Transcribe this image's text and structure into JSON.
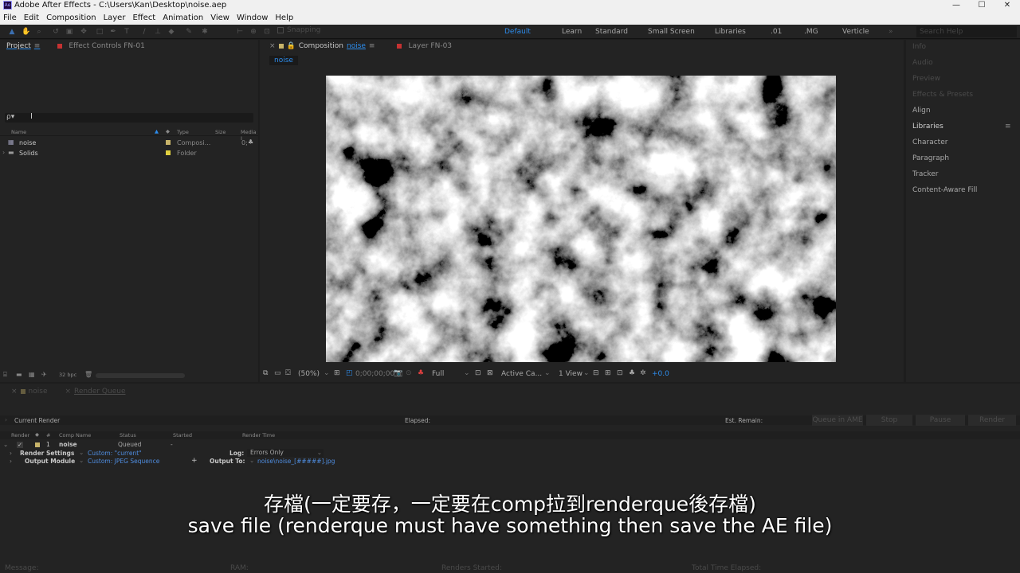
{
  "titlebar": {
    "logo": "Ae",
    "title": "Adobe After Effects - C:\\Users\\Kan\\Desktop\\noise.aep",
    "minimize": "—",
    "maximize": "☐",
    "close": "✕"
  },
  "menubar": [
    "File",
    "Edit",
    "Composition",
    "Layer",
    "Effect",
    "Animation",
    "View",
    "Window",
    "Help"
  ],
  "toolbar": {
    "snapping": "Snapping",
    "search_help_placeholder": "Search Help",
    "workspaces": [
      "Default",
      "Learn",
      "Standard",
      "Small Screen",
      "Libraries",
      ".01",
      ".MG",
      "Verticle"
    ],
    "more": "»"
  },
  "project": {
    "tab_project": "Project",
    "tab_effect_controls": "Effect Controls FN-01",
    "search_placeholder": "ρ▾",
    "columns": [
      "Name",
      "Type",
      "Size",
      "Media I"
    ],
    "items": [
      {
        "name": "noise",
        "type": "Composi...",
        "size": "",
        "media": "0;"
      },
      {
        "name": "Solids",
        "type": "Folder",
        "size": "",
        "media": ""
      }
    ],
    "bpc": "32 bpc"
  },
  "composition": {
    "tab_comp_prefix": "Composition",
    "tab_comp_name": "noise",
    "tab_layer": "Layer FN-03",
    "breadcrumb": "noise",
    "zoom": "(50%)",
    "timecode": "0;00;00;00",
    "resolution": "Full",
    "camera": "Active Ca...",
    "views": "1 View",
    "exposure": "+0.0"
  },
  "right_panel": {
    "items": [
      {
        "label": "Info",
        "dim": true
      },
      {
        "label": "Audio",
        "dim": true
      },
      {
        "label": "Preview",
        "dim": true
      },
      {
        "label": "Effects & Presets",
        "dim": true
      },
      {
        "label": "Align",
        "dim": false
      },
      {
        "label": "Libraries",
        "dim": false
      },
      {
        "label": "Character",
        "dim": false
      },
      {
        "label": "Paragraph",
        "dim": false
      },
      {
        "label": "Tracker",
        "dim": false
      },
      {
        "label": "Content-Aware Fill",
        "dim": false
      }
    ]
  },
  "render_queue": {
    "tab_noise": "noise",
    "tab_render_queue": "Render Queue",
    "current_render": "Current Render",
    "elapsed": "Elapsed:",
    "est_remain": "Est. Remain:",
    "queue_in_ame": "Queue in AME",
    "stop": "Stop",
    "pause": "Pause",
    "render": "Render",
    "columns": [
      "Render",
      "#",
      "Comp Name",
      "Status",
      "Started",
      "Render Time"
    ],
    "row": {
      "num": "1",
      "comp": "noise",
      "status": "Queued",
      "started": "-"
    },
    "render_settings_label": "Render Settings",
    "render_settings_value": "Custom: \"current\"",
    "log_label": "Log:",
    "log_value": "Errors Only",
    "output_module_label": "Output Module",
    "output_module_value": "Custom: JPEG Sequence",
    "output_to_label": "Output To:",
    "output_to_value": "noise\\noise_[#####].jpg"
  },
  "statusbar": {
    "message": "Message:",
    "ram": "RAM:",
    "renders_started": "Renders Started:",
    "total_time": "Total Time Elapsed:"
  },
  "subtitles": {
    "zh": "存檔(一定要存，一定要在comp拉到renderque後存檔)",
    "en": "save file (renderque must have something then save the AE file)"
  }
}
